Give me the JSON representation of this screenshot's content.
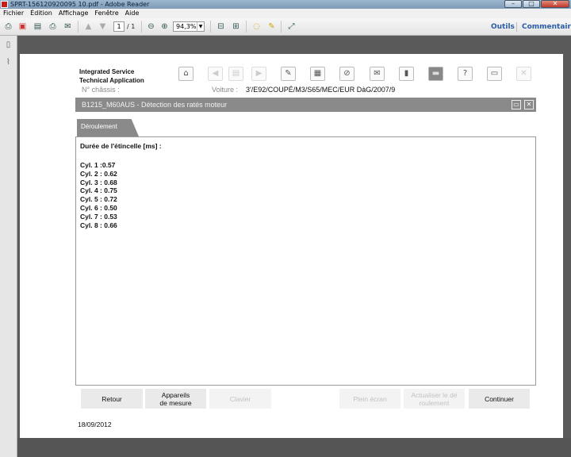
{
  "window": {
    "title": "SPRT-156120920095 10.pdf - Adobe Reader"
  },
  "menu": [
    "Fichier",
    "Édition",
    "Affichage",
    "Fenêtre",
    "Aide"
  ],
  "toolbar": {
    "page_current": "1",
    "page_total": "/ 1",
    "zoom": "94,3%",
    "tools_label": "Outils",
    "comment_label": "Commentaire"
  },
  "document": {
    "app_name_line1": "Integrated Service",
    "app_name_line2": "Technical Application",
    "chassis_label": "N° châssis :",
    "car_label": "Voiture :",
    "car_value": "3'/E92/COUPÉ/M3/S65/MEC/EUR DàG/2007/9",
    "panel_title": "B1215_M60AUS - Détection des ratés moteur",
    "tab_label": "Déroulement",
    "heading": "Durée de l'étincelle [ms] :",
    "cylinders": [
      "Cyl. 1 :0.57",
      "Cyl. 2 : 0.62",
      "Cyl. 3 : 0.68",
      "Cyl. 4 : 0.75",
      "Cyl. 5 : 0.72",
      "Cyl. 6 : 0.50",
      "Cyl. 7 : 0.53",
      "Cyl. 8 : 0.66"
    ],
    "buttons": {
      "back": "Retour",
      "devices_line1": "Appareils",
      "devices_line2": "de mesure",
      "keyboard": "Clavier",
      "fullscreen": "Plein écran",
      "refresh_line1": "Actualiser le dé",
      "refresh_line2": "roulement",
      "continue": "Continuer"
    },
    "date": "18/09/2012"
  }
}
